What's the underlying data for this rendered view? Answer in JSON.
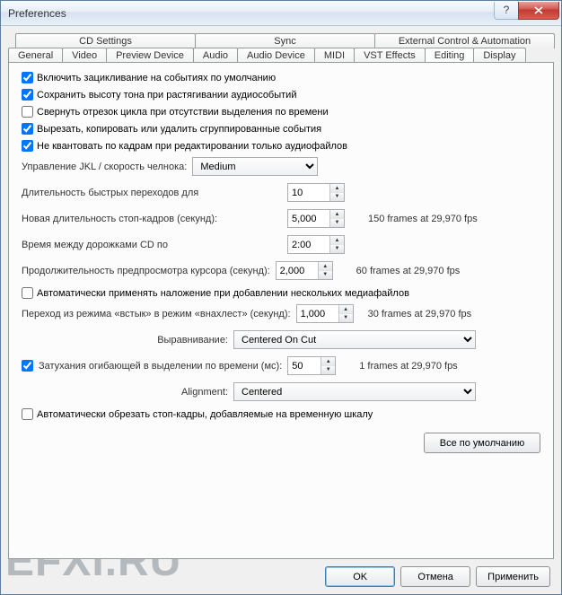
{
  "window": {
    "title": "Preferences"
  },
  "tabs_row1": {
    "cd": "CD Settings",
    "sync": "Sync",
    "ext": "External Control & Automation"
  },
  "tabs_row2": {
    "general": "General",
    "video": "Video",
    "preview": "Preview Device",
    "audio": "Audio",
    "audiodev": "Audio Device",
    "midi": "MIDI",
    "vst": "VST Effects",
    "editing": "Editing",
    "display": "Display"
  },
  "checks": {
    "c1": "Включить зацикливание на событиях по умолчанию",
    "c2": "Сохранить высоту тона при растягивании аудиособытий",
    "c3": "Свернуть отрезок цикла при отсутствии выделения по времени",
    "c4": "Вырезать, копировать или удалить сгруппированные события",
    "c5": "Не квантовать по кадрам при редактировании только аудиофайлов",
    "c6": "Автоматически применять наложение при добавлении нескольких медиафайлов",
    "c7": "Затухания огибающей в выделении по времени (мс):",
    "c8": "Автоматически обрезать стоп-кадры, добавляемые на временную шкалу"
  },
  "labels": {
    "jkl": "Управление JKL / скорость челнока:",
    "quick": "Длительность быстрых переходов для",
    "still": "Новая длительность стоп-кадров (секунд):",
    "cdtime": "Время между дорожками CD по",
    "cursor": "Продолжительность предпросмотра курсора (секунд):",
    "cutto": "Переход из режима «встык» в режим «внахлест» (секунд):",
    "align1": "Выравнивание:",
    "align2": "Alignment:"
  },
  "values": {
    "jkl": "Medium",
    "quick": "10",
    "still": "5,000",
    "cdtime": "2:00",
    "cursor": "2,000",
    "cutto": "1,000",
    "align1": "Centered On Cut",
    "fade": "50",
    "align2": "Centered"
  },
  "hints": {
    "still": "150 frames at 29,970 fps",
    "cursor": "60 frames at 29,970 fps",
    "cutto": "30 frames at 29,970 fps",
    "fade": "1 frames at 29,970 fps"
  },
  "buttons": {
    "defaults": "Все по умолчанию",
    "ok": "OK",
    "cancel": "Отмена",
    "apply": "Применить"
  },
  "watermark": "EFXI.RU"
}
